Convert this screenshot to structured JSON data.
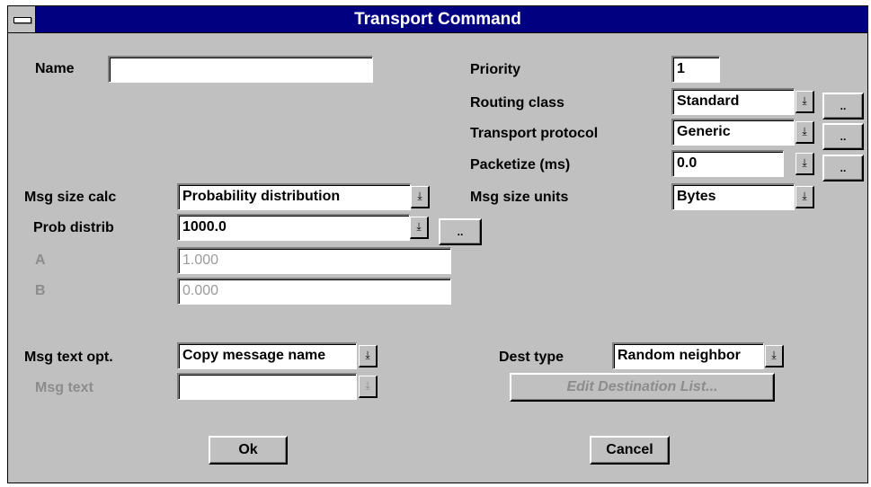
{
  "window": {
    "title": "Transport Command"
  },
  "left": {
    "name_label": "Name",
    "name_value": "",
    "msg_size_calc_label": "Msg size calc",
    "msg_size_calc_value": "Probability distribution",
    "prob_distrib_label": "Prob distrib",
    "prob_distrib_value": "1000.0",
    "a_label": "A",
    "a_value": "1.000",
    "b_label": "B",
    "b_value": "0.000",
    "msg_text_opt_label": "Msg text opt.",
    "msg_text_opt_value": "Copy message name",
    "msg_text_label": "Msg text",
    "msg_text_value": ""
  },
  "right": {
    "priority_label": "Priority",
    "priority_value": "1",
    "routing_class_label": "Routing class",
    "routing_class_value": "Standard",
    "transport_protocol_label": "Transport protocol",
    "transport_protocol_value": "Generic",
    "packetize_label": "Packetize (ms)",
    "packetize_value": "0.0",
    "msg_size_units_label": "Msg size units",
    "msg_size_units_value": "Bytes",
    "dest_type_label": "Dest type",
    "dest_type_value": "Random neighbor",
    "edit_dest_label": "Edit Destination List..."
  },
  "buttons": {
    "ok": "Ok",
    "cancel": "Cancel",
    "ellipsis": ".."
  },
  "icons": {
    "dropdown_arrow": "⤓",
    "system_menu": "system-menu-icon"
  }
}
